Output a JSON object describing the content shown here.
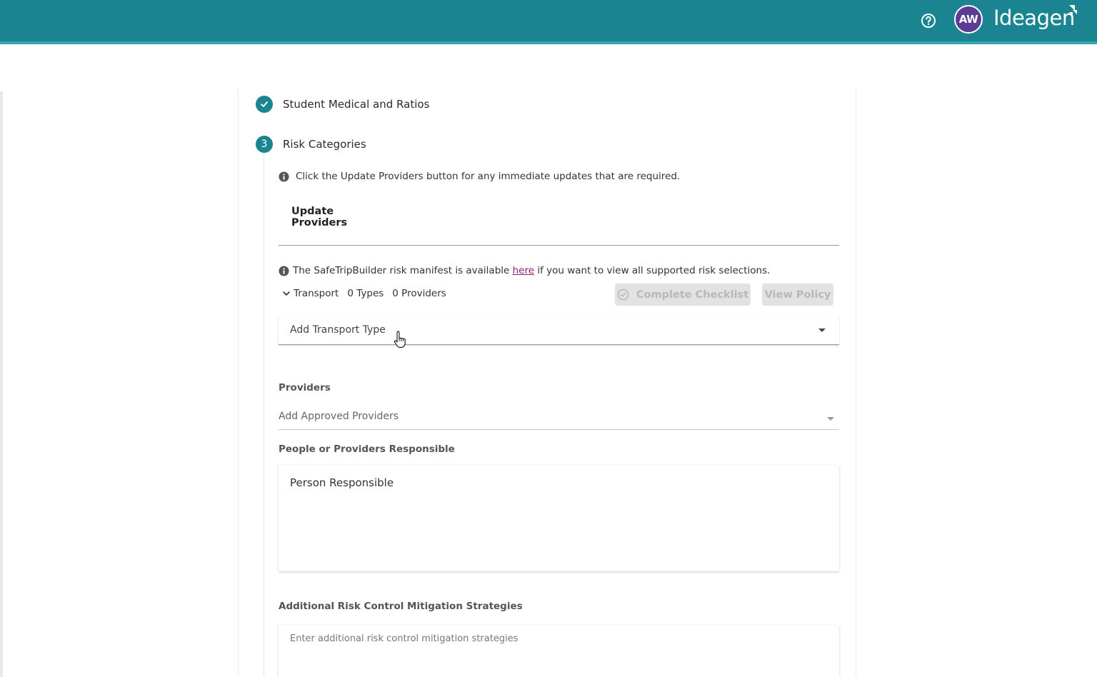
{
  "header": {
    "avatar_initials": "AW",
    "brand_name": "Ideagen",
    "bg_color": "#1a8590",
    "help_icon": "help-circle-icon"
  },
  "steps": [
    {
      "state": "complete",
      "icon": "check-icon",
      "label": "Student Medical and Ratios"
    },
    {
      "state": "active",
      "number": "3",
      "label": "Risk Categories"
    }
  ],
  "risk": {
    "info_update": "Click the Update Providers button for any immediate updates that are required.",
    "update_providers_label": "Update Providers",
    "manifest_prefix": "The SafeTripBuilder risk manifest is available ",
    "manifest_link": "here",
    "manifest_suffix": " if you want to view all supported risk selections.",
    "transport": {
      "label": "Transport",
      "types": "0 Types",
      "providers": "0 Providers",
      "complete_checklist_label": "Complete Checklist",
      "view_policy_label": "View Policy",
      "add_type_placeholder": "Add Transport Type"
    },
    "providers_label": "Providers",
    "providers_placeholder": "Add Approved Providers",
    "responsible_label": "People or Providers Responsible",
    "responsible_value": "Person Responsible",
    "mitigation_label": "Additional Risk Control Mitigation Strategies",
    "mitigation_placeholder": "Enter additional risk control mitigation strategies"
  }
}
